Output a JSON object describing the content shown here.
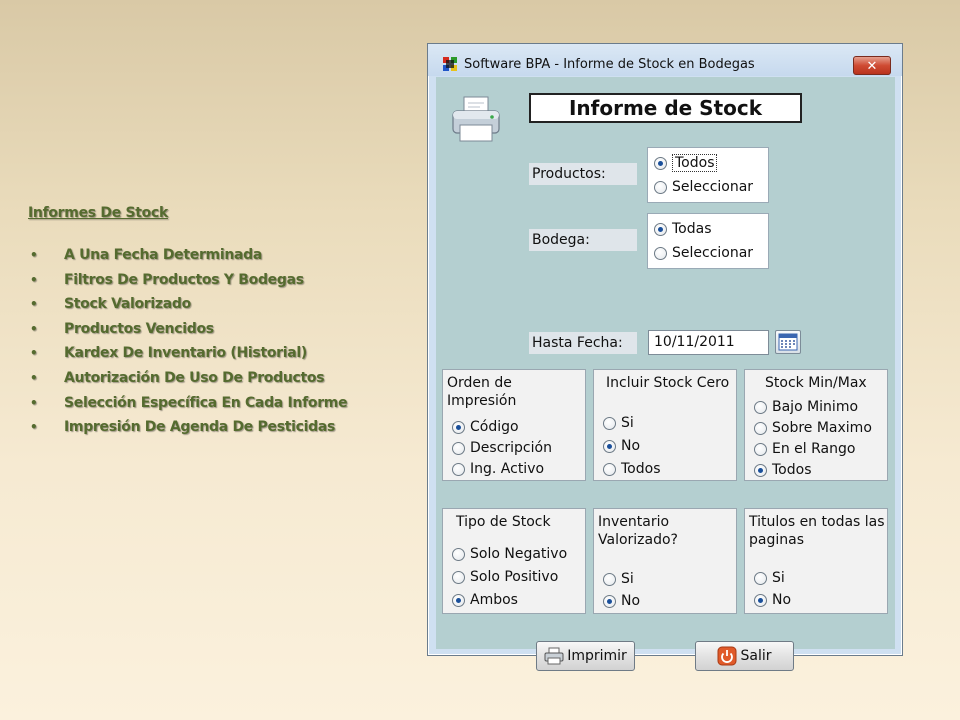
{
  "slide": {
    "heading": "Informes De Stock",
    "bullet_glyph": "•",
    "items": [
      "A Una Fecha Determinada",
      "Filtros De Productos Y Bodegas",
      "Stock Valorizado",
      "Productos Vencidos",
      "Kardex De Inventario (Historial)",
      "Autorización De Uso De Productos",
      "Selección Específica En Cada Informe",
      "Impresión De Agenda De Pesticidas"
    ]
  },
  "window": {
    "title": "Software BPA - Informe de Stock en Bodegas",
    "close_glyph": "✕",
    "report_title": "Informe de Stock",
    "productos": {
      "label": "Productos:",
      "options": [
        "Todos",
        "Seleccionar"
      ],
      "selected": "Todos"
    },
    "bodega": {
      "label": "Bodega:",
      "options": [
        "Todas",
        "Seleccionar"
      ],
      "selected": "Todas"
    },
    "hasta_fecha": {
      "label": "Hasta Fecha:",
      "value": "10/11/2011"
    },
    "orden_impresion": {
      "title": "Orden de Impresión",
      "options": [
        "Código",
        "Descripción",
        "Ing. Activo"
      ],
      "selected": "Código"
    },
    "incluir_stock_cero": {
      "title": "Incluir Stock Cero",
      "options": [
        "Si",
        "No",
        "Todos"
      ],
      "selected": "No"
    },
    "stock_min_max": {
      "title": "Stock Min/Max",
      "options": [
        "Bajo Minimo",
        "Sobre Maximo",
        "En el Rango",
        "Todos"
      ],
      "selected": "Todos"
    },
    "tipo_stock": {
      "title": "Tipo de Stock",
      "options": [
        "Solo Negativo",
        "Solo Positivo",
        "Ambos"
      ],
      "selected": "Ambos"
    },
    "inventario_valorizado": {
      "title_line1": "Inventario",
      "title_line2": "Valorizado?",
      "options": [
        "Si",
        "No"
      ],
      "selected": "No"
    },
    "titulos_paginas": {
      "title_line1": "Titulos en todas las",
      "title_line2": "paginas",
      "options": [
        "Si",
        "No"
      ],
      "selected": "No"
    },
    "buttons": {
      "print": "Imprimir",
      "exit": "Salir"
    }
  },
  "colors": {
    "slide_text": "#556b2f",
    "window_client": "#b4cfd0",
    "close_button": "#c8432c"
  }
}
